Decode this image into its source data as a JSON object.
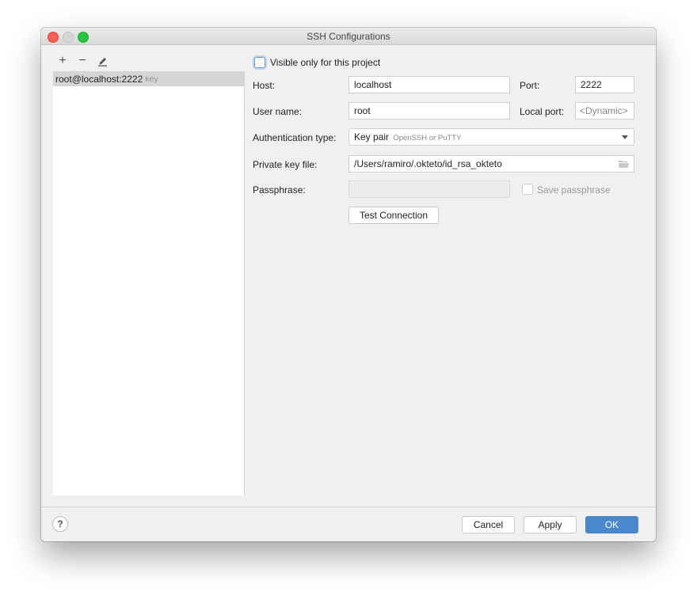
{
  "window": {
    "title": "SSH Configurations"
  },
  "toolbar": {
    "add_icon": "+",
    "remove_icon": "−",
    "edit_icon": "pencil"
  },
  "list": {
    "items": [
      {
        "label": "root@localhost:2222",
        "hint": "key",
        "selected": true
      }
    ]
  },
  "form": {
    "visible_only_label": "Visible only for this project",
    "visible_only_checked": false,
    "host_label": "Host:",
    "host_value": "localhost",
    "port_label": "Port:",
    "port_value": "2222",
    "username_label": "User name:",
    "username_value": "root",
    "local_port_label": "Local port:",
    "local_port_placeholder": "<Dynamic>",
    "auth_label": "Authentication type:",
    "auth_value": "Key pair",
    "auth_hint": "OpenSSH or PuTTY",
    "key_file_label": "Private key file:",
    "key_file_value": "/Users/ramiro/.okteto/id_rsa_okteto",
    "passphrase_label": "Passphrase:",
    "passphrase_value": "",
    "save_passphrase_label": "Save passphrase",
    "save_passphrase_checked": false,
    "test_connection_label": "Test Connection"
  },
  "footer": {
    "help_label": "?",
    "cancel_label": "Cancel",
    "apply_label": "Apply",
    "ok_label": "OK"
  },
  "colors": {
    "primary_button": "#4a88cb",
    "close": "#fc5f57",
    "maximize": "#29c440"
  }
}
